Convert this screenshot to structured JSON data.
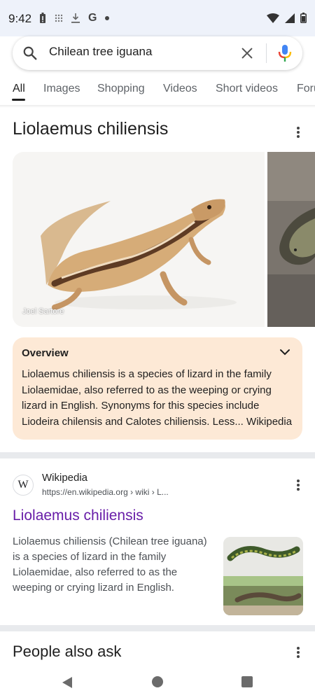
{
  "status_bar": {
    "time": "9:42",
    "left_icons": [
      "battery-saver-icon",
      "grid-icon",
      "download-icon",
      "google-g-icon",
      "dot-icon"
    ],
    "google_letter": "G",
    "right_icons": [
      "wifi-icon",
      "signal-icon",
      "battery-icon"
    ]
  },
  "search": {
    "query": "Chilean tree iguana"
  },
  "tabs": [
    {
      "label": "All",
      "active": true
    },
    {
      "label": "Images"
    },
    {
      "label": "Shopping"
    },
    {
      "label": "Videos"
    },
    {
      "label": "Short videos"
    },
    {
      "label": "Forums"
    }
  ],
  "knowledge_panel": {
    "title": "Liolaemus chiliensis",
    "image_credit": "Joel Sartore",
    "overview": {
      "heading": "Overview",
      "text": "Liolaemus chiliensis is a species of lizard in the family Liolaemidae, also referred to as the weeping or crying lizard in English. Synonyms for this species include Liodeira chilensis and Calotes chiliensis. Less",
      "ellipsis": "...",
      "source": "Wikipedia"
    }
  },
  "result": {
    "favicon_letter": "W",
    "site_name": "Wikipedia",
    "url": "https://en.wikipedia.org › wiki › L...",
    "title": "Liolaemus chiliensis",
    "snippet": "Liolaemus chiliensis (Chilean tree iguana) is a species of lizard in the family Liolaemidae, also referred to as the weeping or crying lizard in English."
  },
  "people_also_ask": {
    "title": "People also ask"
  },
  "colors": {
    "overview_bg": "#fde9d6",
    "link_visited": "#681da8",
    "mic_blue": "#4285f4",
    "mic_red": "#ea4335",
    "mic_yellow": "#fbbc04",
    "mic_green": "#34a853"
  }
}
